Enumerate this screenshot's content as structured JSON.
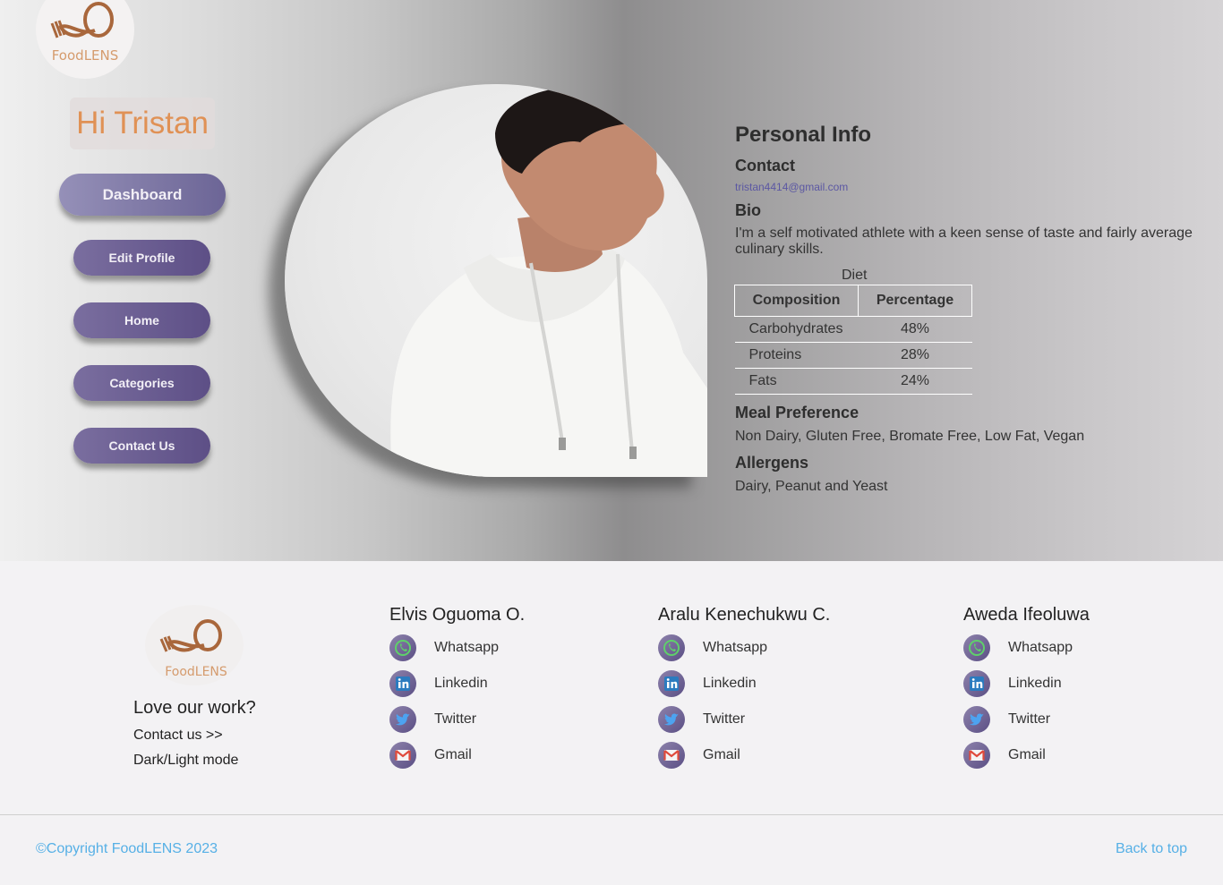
{
  "app": {
    "logo_text": "FoodLENS"
  },
  "sidebar": {
    "greeting": "Hi Tristan",
    "nav": [
      {
        "label": "Dashboard"
      },
      {
        "label": "Edit Profile"
      },
      {
        "label": "Home"
      },
      {
        "label": "Categories"
      },
      {
        "label": "Contact Us"
      }
    ]
  },
  "profile": {
    "heading": "Personal Info",
    "contact_label": "Contact",
    "email": "tristan4414@gmail.com",
    "bio_label": "Bio",
    "bio": "I'm a self motivated athlete with a keen sense of taste and fairly average culinary skills.",
    "diet": {
      "caption": "Diet",
      "headers": [
        "Composition",
        "Percentage"
      ],
      "rows": [
        {
          "composition": "Carbohydrates",
          "percentage": "48%"
        },
        {
          "composition": "Proteins",
          "percentage": "28%"
        },
        {
          "composition": "Fats",
          "percentage": "24%"
        }
      ]
    },
    "meal_label": "Meal Preference",
    "meal": "Non Dairy, Gluten Free, Bromate Free, Low Fat, Vegan",
    "allergens_label": "Allergens",
    "allergens": "Dairy, Peanut and Yeast"
  },
  "footer": {
    "tagline": "Love our work?",
    "contact_link": "Contact us >>",
    "mode_toggle": "Dark/Light mode",
    "people": [
      {
        "name": "Elvis Oguoma O.",
        "links": [
          "Whatsapp",
          "Linkedin",
          "Twitter",
          "Gmail"
        ]
      },
      {
        "name": "Aralu Kenechukwu C.",
        "links": [
          "Whatsapp",
          "Linkedin",
          "Twitter",
          "Gmail"
        ]
      },
      {
        "name": "Aweda Ifeoluwa",
        "links": [
          "Whatsapp",
          "Linkedin",
          "Twitter",
          "Gmail"
        ]
      }
    ],
    "copyright": "©Copyright FoodLENS 2023",
    "back_to_top": "Back to top"
  },
  "icons": [
    "whatsapp-icon",
    "linkedin-icon",
    "twitter-icon",
    "gmail-icon"
  ],
  "colors": {
    "accent": "#e09155",
    "nav": "#5d4f86",
    "link": "#56b0e6"
  }
}
